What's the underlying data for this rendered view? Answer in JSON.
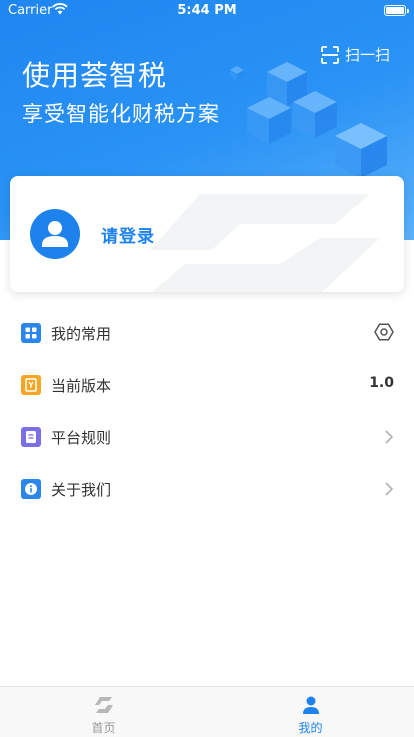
{
  "status_bar": {
    "carrier": "Carrier",
    "time": "5:44 PM"
  },
  "header": {
    "scan_label": "扫一扫",
    "title": "使用荟智税",
    "subtitle": "享受智能化财税方案"
  },
  "profile_card": {
    "login_label": "请登录"
  },
  "menu": {
    "items": [
      {
        "label": "我的常用",
        "icon": "grid-icon",
        "color": "#2a86ea"
      },
      {
        "label": "当前版本",
        "icon": "version-icon",
        "color": "#f5a623",
        "value": "1.0"
      },
      {
        "label": "平台规则",
        "icon": "document-icon",
        "color": "#7b6fe8"
      },
      {
        "label": "关于我们",
        "icon": "info-icon",
        "color": "#2a86ea"
      }
    ]
  },
  "tab_bar": {
    "tabs": [
      {
        "label": "首页",
        "active": false
      },
      {
        "label": "我的",
        "active": true
      }
    ]
  },
  "colors": {
    "primary": "#1e82ec",
    "inactive": "#999999"
  }
}
